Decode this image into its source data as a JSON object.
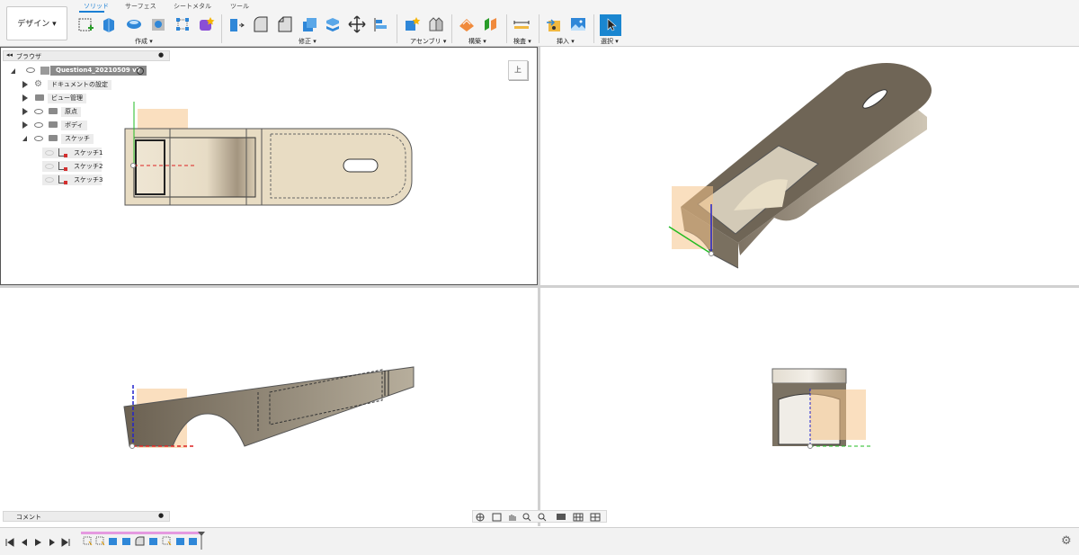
{
  "toolbar": {
    "workspace": "デザイン ▾",
    "tabs": [
      "ソリッド",
      "サーフェス",
      "シートメタル",
      "ツール"
    ],
    "groups": [
      "作成 ▾",
      "修正 ▾",
      "アセンブリ ▾",
      "構築 ▾",
      "検査 ▾",
      "挿入 ▾",
      "選択 ▾"
    ],
    "accent": "#1b7fd4"
  },
  "browser": {
    "title": "ブラウザ",
    "root": "Question4_20210509 v7",
    "items": [
      "ドキュメントの設定",
      "ビュー管理",
      "原点",
      "ボディ",
      "スケッチ"
    ],
    "sketches": [
      "スケッチ1",
      "スケッチ2",
      "スケッチ3"
    ]
  },
  "viewcube": {
    "label": "上"
  },
  "comments": {
    "title": "コメント"
  },
  "colors": {
    "body": "#e8dcc3",
    "plane": "#f5c58a",
    "axis_green": "#22bb22",
    "axis_blue": "#2222cc",
    "axis_red": "#dd2222"
  }
}
